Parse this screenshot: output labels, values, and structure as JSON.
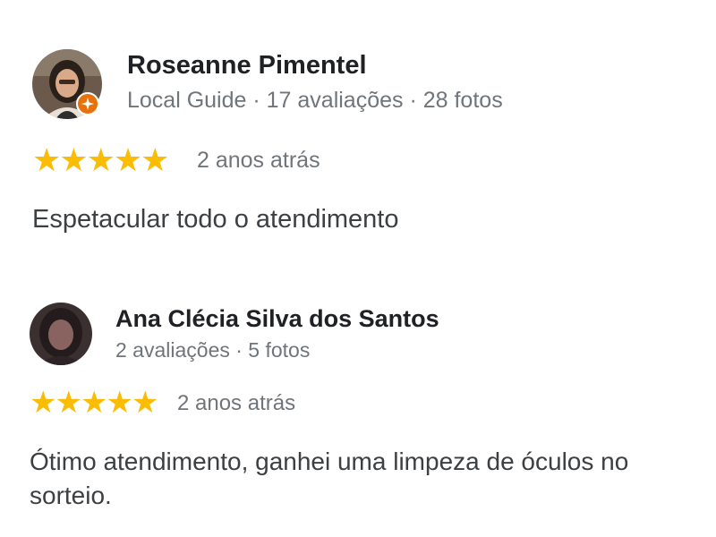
{
  "reviews": [
    {
      "author": "Roseanne Pimentel",
      "author_meta": "Local Guide · 17 avaliações · 28 fotos",
      "is_local_guide": true,
      "rating": 5,
      "stars": [
        "★",
        "★",
        "★",
        "★",
        "★"
      ],
      "time_ago": "2 anos atrás",
      "text": "Espetacular todo o atendimento",
      "avatar_icon": "user-photo",
      "badge_icon": "local-guide-star-badge"
    },
    {
      "author": "Ana Clécia Silva dos Santos",
      "author_meta": "2 avaliações · 5 fotos",
      "is_local_guide": false,
      "rating": 5,
      "stars": [
        "★",
        "★",
        "★",
        "★",
        "★"
      ],
      "time_ago": "2 anos atrás",
      "text": "Ótimo atendimento, ganhei uma limpeza de óculos no sorteio.",
      "avatar_icon": "user-photo"
    }
  ],
  "colors": {
    "star": "#fbbc04",
    "badge": "#e8710a",
    "name": "#202124",
    "meta": "#70757a",
    "body": "#3c4043"
  }
}
